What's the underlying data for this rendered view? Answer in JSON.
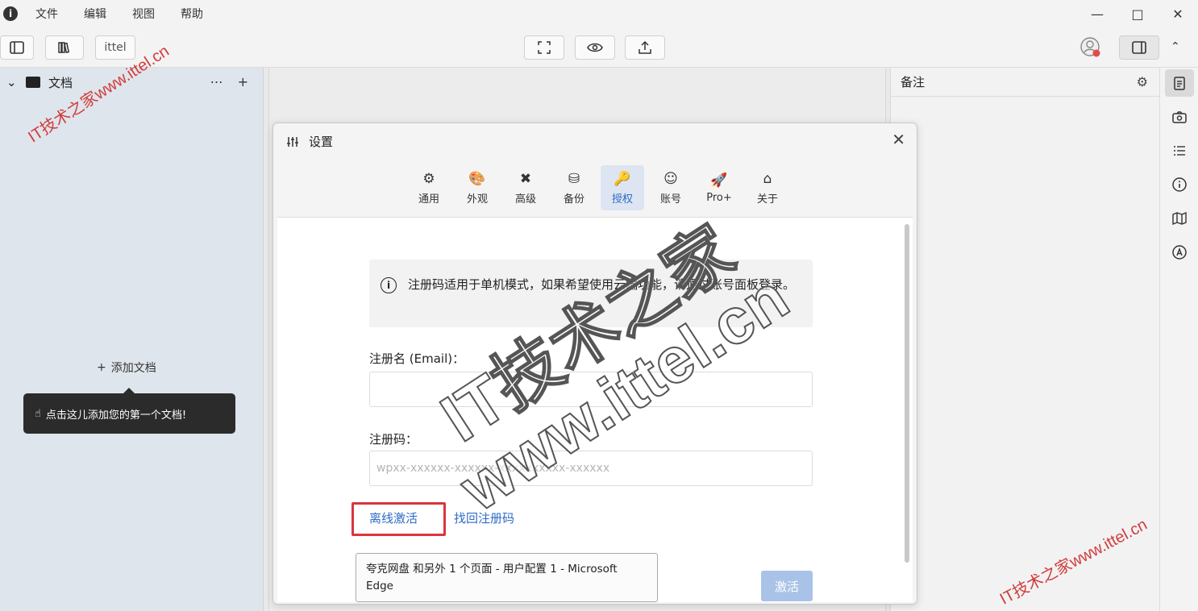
{
  "menu": [
    "文件",
    "编辑",
    "视图",
    "帮助"
  ],
  "toolbar": {
    "tab_label": "ittel"
  },
  "sidebar": {
    "section_title": "文档",
    "add_doc": "添加文档",
    "tooltip": "点击这儿添加您的第一个文档!"
  },
  "notes": {
    "title": "备注"
  },
  "settings": {
    "title": "设置",
    "tabs": [
      {
        "label": "通用",
        "icon": "gear-icon"
      },
      {
        "label": "外观",
        "icon": "palette-icon"
      },
      {
        "label": "高级",
        "icon": "tools-icon"
      },
      {
        "label": "备份",
        "icon": "database-icon"
      },
      {
        "label": "授权",
        "icon": "key-icon",
        "active": true
      },
      {
        "label": "账号",
        "icon": "user-icon"
      },
      {
        "label": "Pro+",
        "icon": "rocket-icon"
      },
      {
        "label": "关于",
        "icon": "home-icon"
      }
    ],
    "info": "注册码适用于单机模式，如果希望使用云端功能，请通过账号面板登录。",
    "email_label": "注册名 (Email)：",
    "email_value": "",
    "code_label": "注册码：",
    "code_placeholder": "wpxx-xxxxxx-xxxxxx-xxxxxxxxxx-xxxxxx",
    "offline_activate": "离线激活",
    "retrieve_code": "找回注册码",
    "activate": "激活"
  },
  "browser_tip": "夸克网盘 和另外 1 个页面 - 用户配置 1 - Microsoft Edge",
  "watermark": {
    "small": "IT技术之家www.ittel.cn",
    "big_line1": "IT技术之家",
    "big_line2": "www.ittel.cn"
  },
  "colors": {
    "accent": "#2f6bc7",
    "highlight": "#d9363e",
    "activate_disabled": "#a9c3e8"
  }
}
